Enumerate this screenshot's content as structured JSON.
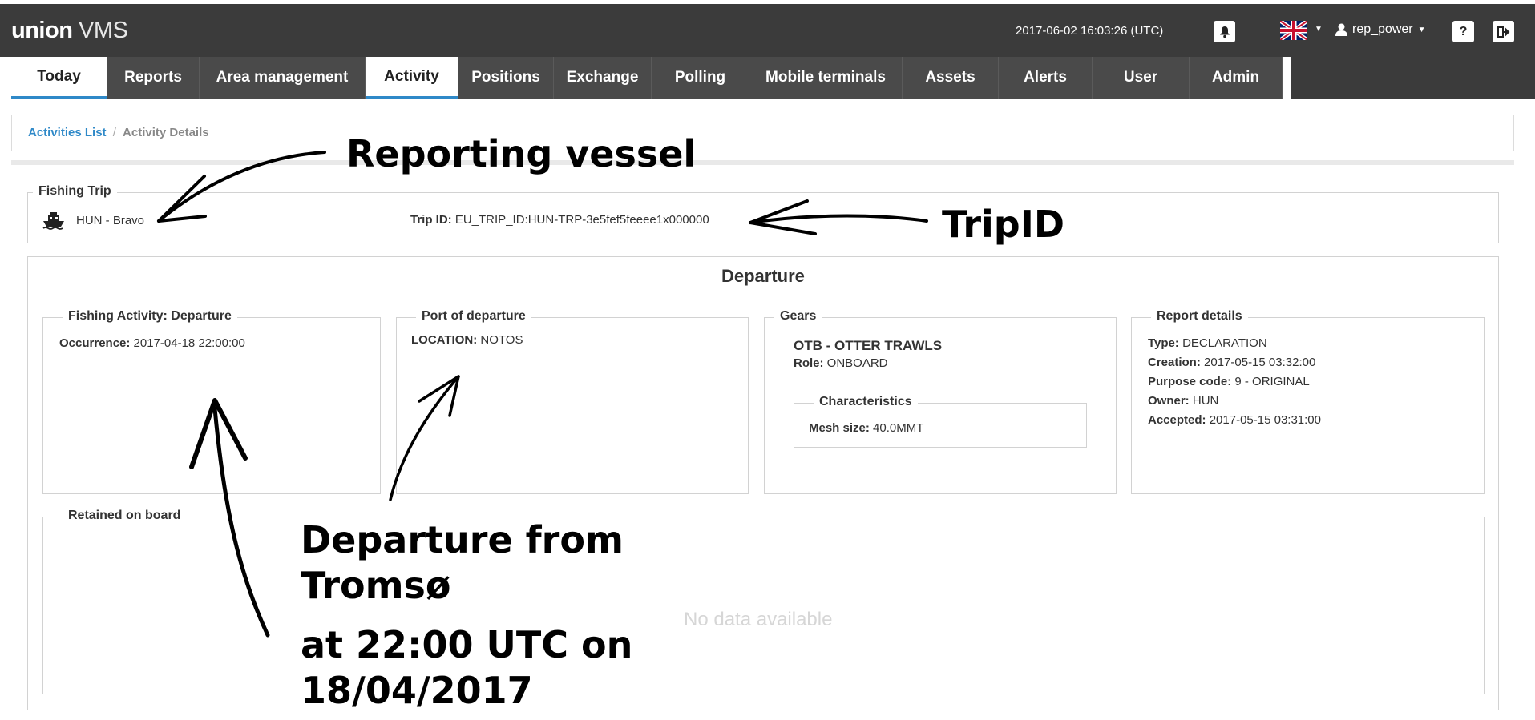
{
  "header": {
    "brand_bold": "union",
    "brand_light": "VMS",
    "datetime": "2017-06-02 16:03:26 (UTC)",
    "username": "rep_power",
    "help_label": "?"
  },
  "nav": {
    "items": [
      {
        "label": "Today",
        "active": true
      },
      {
        "label": "Reports"
      },
      {
        "label": "Area management"
      },
      {
        "label": "Activity",
        "active": true
      },
      {
        "label": "Positions"
      },
      {
        "label": "Exchange"
      },
      {
        "label": "Polling"
      },
      {
        "label": "Mobile terminals"
      },
      {
        "label": "Assets"
      },
      {
        "label": "Alerts"
      },
      {
        "label": "User"
      },
      {
        "label": "Admin"
      }
    ]
  },
  "breadcrumb": {
    "link": "Activities List",
    "separator": "/",
    "current": "Activity Details"
  },
  "trip": {
    "legend": "Fishing Trip",
    "vessel": "HUN - Bravo",
    "trip_id_label": "Trip ID:",
    "trip_id_value": "EU_TRIP_ID:HUN-TRP-3e5fef5feeee1x000000"
  },
  "departure": {
    "title": "Departure",
    "activity": {
      "legend": "Fishing Activity: Departure",
      "occurrence_label": "Occurrence:",
      "occurrence_value": "2017-04-18 22:00:00"
    },
    "port": {
      "legend": "Port of departure",
      "location_label": "LOCATION:",
      "location_value": "NOTOS"
    },
    "gears": {
      "legend": "Gears",
      "gear_name": "OTB - OTTER TRAWLS",
      "role_label": "Role:",
      "role_value": "ONBOARD",
      "characteristics_legend": "Characteristics",
      "mesh_label": "Mesh size:",
      "mesh_value": "40.0MMT"
    },
    "report": {
      "legend": "Report details",
      "type_label": "Type:",
      "type_value": "DECLARATION",
      "creation_label": "Creation:",
      "creation_value": "2017-05-15 03:32:00",
      "purpose_label": "Purpose code:",
      "purpose_value": "9 - ORIGINAL",
      "owner_label": "Owner:",
      "owner_value": "HUN",
      "accepted_label": "Accepted:",
      "accepted_value": "2017-05-15 03:31:00"
    },
    "retained": {
      "legend": "Retained on board",
      "empty_text": "No data available"
    }
  },
  "annotations": {
    "reporting_vessel": "Reporting vessel",
    "trip_id": "TripID",
    "departure_line1": "Departure from",
    "departure_line2": "Tromsø",
    "departure_line3": "at 22:00 UTC on",
    "departure_line4": "18/04/2017"
  }
}
